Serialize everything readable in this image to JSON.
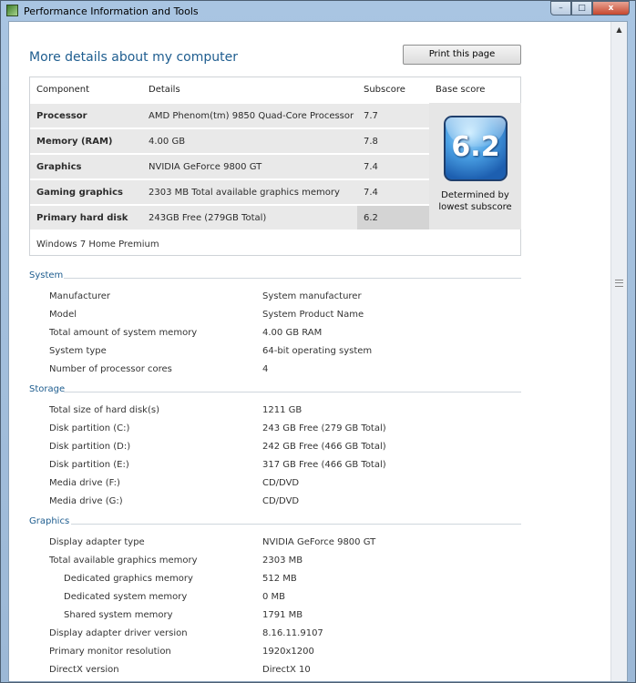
{
  "window": {
    "title": "Performance Information and Tools",
    "buttons": {
      "minimize": "–",
      "maximize": "□",
      "close": "x"
    }
  },
  "page": {
    "heading": "More details about my computer",
    "print_button": "Print this page"
  },
  "score_table": {
    "headers": {
      "component": "Component",
      "details": "Details",
      "subscore": "Subscore",
      "base": "Base score"
    },
    "rows": [
      {
        "component": "Processor",
        "details": "AMD Phenom(tm) 9850 Quad-Core Processor",
        "subscore": "7.7"
      },
      {
        "component": "Memory (RAM)",
        "details": "4.00 GB",
        "subscore": "7.8"
      },
      {
        "component": "Graphics",
        "details": "NVIDIA GeForce 9800 GT",
        "subscore": "7.4"
      },
      {
        "component": "Gaming graphics",
        "details": "2303 MB Total available graphics memory",
        "subscore": "7.4"
      },
      {
        "component": "Primary hard disk",
        "details": "243GB Free (279GB Total)",
        "subscore": "6.2"
      }
    ],
    "base_score": "6.2",
    "base_caption_1": "Determined by",
    "base_caption_2": "lowest subscore",
    "edition": "Windows 7 Home Premium"
  },
  "system": {
    "title": "System",
    "rows": [
      {
        "label": "Manufacturer",
        "value": "System manufacturer"
      },
      {
        "label": "Model",
        "value": "System Product Name"
      },
      {
        "label": "Total amount of system memory",
        "value": "4.00 GB RAM"
      },
      {
        "label": "System type",
        "value": "64-bit operating system"
      },
      {
        "label": "Number of processor cores",
        "value": "4"
      }
    ]
  },
  "storage": {
    "title": "Storage",
    "rows": [
      {
        "label": "Total size of hard disk(s)",
        "value": "1211 GB"
      },
      {
        "label": "Disk partition (C:)",
        "value": "243 GB Free (279 GB Total)"
      },
      {
        "label": "Disk partition (D:)",
        "value": "242 GB Free (466 GB Total)"
      },
      {
        "label": "Disk partition (E:)",
        "value": "317 GB Free (466 GB Total)"
      },
      {
        "label": "Media drive (F:)",
        "value": "CD/DVD"
      },
      {
        "label": "Media drive (G:)",
        "value": "CD/DVD"
      }
    ]
  },
  "graphics": {
    "title": "Graphics",
    "rows": [
      {
        "label": "Display adapter type",
        "value": "NVIDIA GeForce 9800 GT"
      },
      {
        "label": "Total available graphics memory",
        "value": "2303 MB"
      },
      {
        "label": "Dedicated graphics memory",
        "value": "512 MB"
      },
      {
        "label": "Dedicated system memory",
        "value": "0 MB"
      },
      {
        "label": "Shared system memory",
        "value": "1791 MB"
      },
      {
        "label": "Display adapter driver version",
        "value": "8.16.11.9107"
      },
      {
        "label": "Primary monitor resolution",
        "value": "1920x1200"
      },
      {
        "label": "DirectX version",
        "value": "DirectX 10"
      }
    ]
  },
  "colors": {
    "accent": "#1e5d8f",
    "row_bg": "#e9e9e9"
  }
}
